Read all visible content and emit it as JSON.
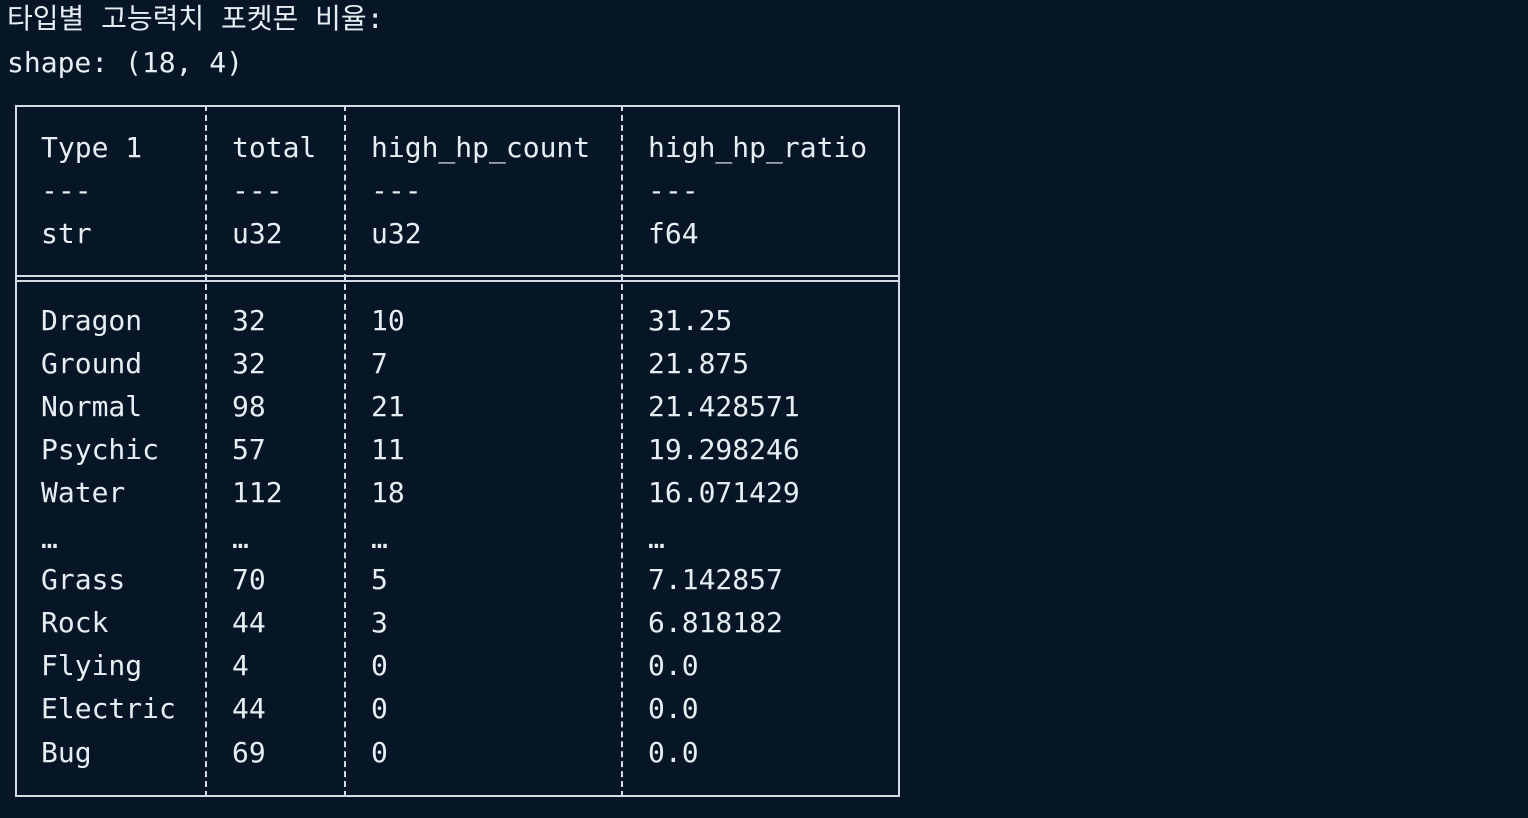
{
  "output": {
    "title": "타입별 고능력치 포켓몬 비율:",
    "shape": "shape: (18, 4)"
  },
  "table": {
    "columns": [
      {
        "name": "Type 1",
        "sep": "---",
        "dtype": "str"
      },
      {
        "name": "total",
        "sep": "---",
        "dtype": "u32"
      },
      {
        "name": "high_hp_count",
        "sep": "---",
        "dtype": "u32"
      },
      {
        "name": "high_hp_ratio",
        "sep": "---",
        "dtype": "f64"
      }
    ],
    "rows": [
      [
        "Dragon",
        "32",
        "10",
        "31.25"
      ],
      [
        "Ground",
        "32",
        "7",
        "21.875"
      ],
      [
        "Normal",
        "98",
        "21",
        "21.428571"
      ],
      [
        "Psychic",
        "57",
        "11",
        "19.298246"
      ],
      [
        "Water",
        "112",
        "18",
        "16.071429"
      ],
      [
        "…",
        "…",
        "…",
        "…"
      ],
      [
        "Grass",
        "70",
        "5",
        "7.142857"
      ],
      [
        "Rock",
        "44",
        "3",
        "6.818182"
      ],
      [
        "Flying",
        "4",
        "0",
        "0.0"
      ],
      [
        "Electric",
        "44",
        "0",
        "0.0"
      ],
      [
        "Bug",
        "69",
        "0",
        "0.0"
      ]
    ]
  }
}
